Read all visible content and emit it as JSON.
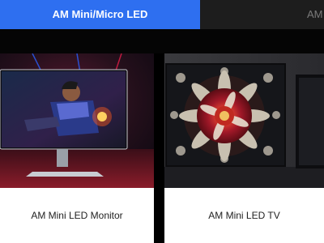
{
  "tabs": [
    {
      "label": "AM Mini/Micro LED",
      "active": true
    },
    {
      "label": "AM O",
      "active": false
    }
  ],
  "products": [
    {
      "label": "AM Mini LED Monitor",
      "image": "gaming-monitor-image"
    },
    {
      "label": "AM Mini LED TV",
      "image": "television-image"
    }
  ],
  "colors": {
    "accent": "#2e6ff0",
    "tab_inactive_bg": "#1d1d1d",
    "card_bg": "#ffffff"
  }
}
